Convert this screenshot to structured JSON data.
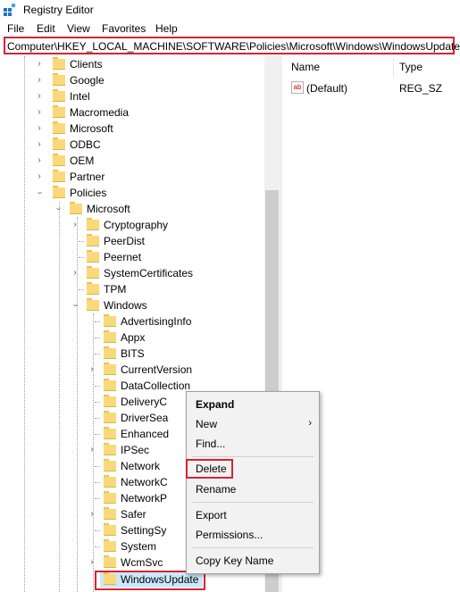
{
  "window": {
    "title": "Registry Editor"
  },
  "menu": [
    "File",
    "Edit",
    "View",
    "Favorites",
    "Help"
  ],
  "address_bar": {
    "path": "Computer\\HKEY_LOCAL_MACHINE\\SOFTWARE\\Policies\\Microsoft\\Windows\\WindowsUpdate"
  },
  "tree": {
    "software_children": [
      "Clients",
      "Google",
      "Intel",
      "Macromedia",
      "Microsoft",
      "ODBC",
      "OEM",
      "Partner",
      "Policies"
    ],
    "policies_children": [
      "Microsoft"
    ],
    "policies_microsoft_children": [
      "Cryptography",
      "PeerDist",
      "Peernet",
      "SystemCertificates",
      "TPM",
      "Windows"
    ],
    "windows_children": [
      "AdvertisingInfo",
      "Appx",
      "BITS",
      "CurrentVersion",
      "DataCollection",
      "DeliveryC",
      "DriverSea",
      "Enhanced",
      "IPSec",
      "Network",
      "NetworkC",
      "NetworkP",
      "Safer",
      "SettingSy",
      "System",
      "WcmSvc",
      "WindowsUpdate"
    ]
  },
  "values_pane": {
    "columns": {
      "name": "Name",
      "type": "Type"
    },
    "rows": [
      {
        "name": "(Default)",
        "type": "REG_SZ",
        "icon": "string-value-icon"
      }
    ]
  },
  "context_menu": {
    "items": {
      "expand": "Expand",
      "new": "New",
      "find": "Find...",
      "delete": "Delete",
      "rename": "Rename",
      "export": "Export",
      "permissions": "Permissions...",
      "copy_key_name": "Copy Key Name"
    },
    "submenu_arrow": "›"
  },
  "colors": {
    "highlight": "#d9232f",
    "folder": "#f9d97a",
    "selection": "#cce8ff"
  }
}
